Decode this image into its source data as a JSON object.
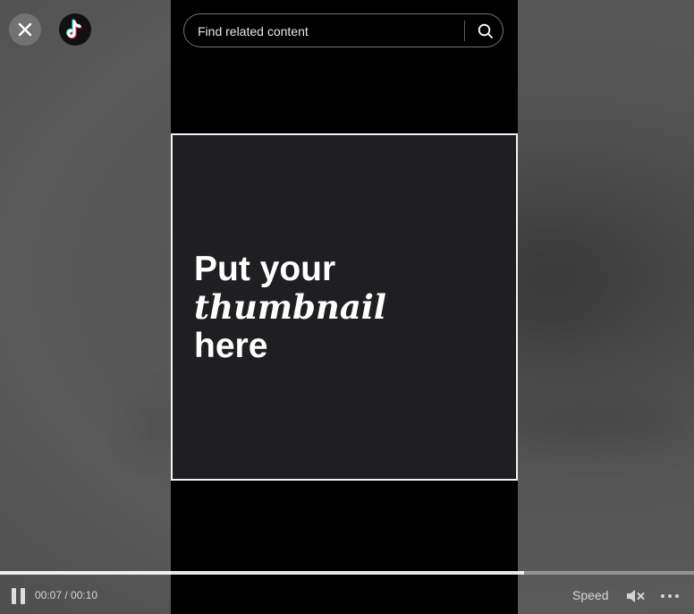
{
  "header": {
    "close_icon": "close-icon",
    "logo_icon": "tiktok-logo-icon"
  },
  "search": {
    "placeholder": "Find related content",
    "value": "",
    "icon": "search-icon"
  },
  "thumbnail": {
    "line1": "Put your",
    "line2": "thumbnail",
    "line3": "here"
  },
  "player": {
    "current_time": "00:07",
    "duration": "00:10",
    "time_display": "00:07 / 00:10",
    "progress_fraction": 0.755,
    "speed_label": "Speed",
    "pause_icon": "pause-icon",
    "mute_icon": "muted-speaker-icon",
    "more_icon": "more-options-icon"
  },
  "colors": {
    "background": "#4a4a4a",
    "video_column": "#000000",
    "thumbnail_bg": "#1f1f21",
    "thumbnail_border": "#f2f2f2",
    "text": "#ffffff"
  }
}
